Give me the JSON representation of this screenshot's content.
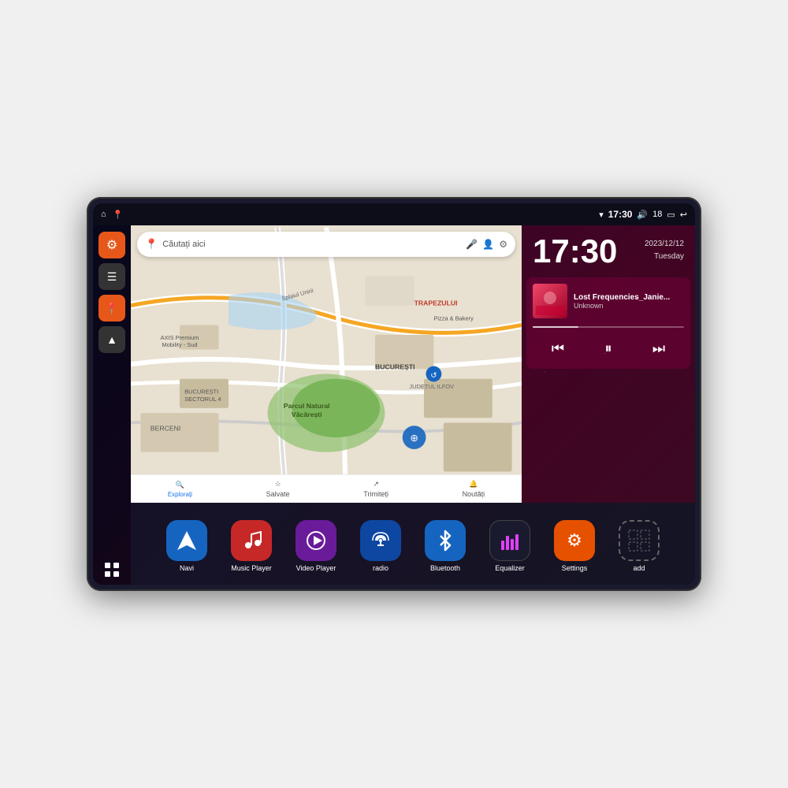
{
  "device": {
    "title": "Car Android Head Unit"
  },
  "statusBar": {
    "leftIcons": [
      "home",
      "maps"
    ],
    "wifi": "▼",
    "time": "17:30",
    "volume": "🔊",
    "battery": "18",
    "batteryIcon": "🔋",
    "back": "↩"
  },
  "sidebar": {
    "buttons": [
      {
        "id": "settings",
        "icon": "⚙",
        "color": "orange"
      },
      {
        "id": "folder",
        "icon": "☰",
        "color": "dark"
      },
      {
        "id": "map",
        "icon": "📍",
        "color": "orange"
      },
      {
        "id": "navigation",
        "icon": "▲",
        "color": "dark"
      }
    ],
    "appsButton": "⋮⋮⋮"
  },
  "map": {
    "searchPlaceholder": "Căutați aici",
    "area": "București",
    "locations": [
      "Parcul Natural Văcărești",
      "AXIS Premium Mobility - Sud",
      "Pizza & Bakery",
      "TRAPEZULUI",
      "BUCUREȘTI SECTORUL 4",
      "BUCUREȘTI",
      "JUDEȚUL ILFOV",
      "BERCENI"
    ],
    "bottomNav": [
      {
        "label": "Explorați",
        "icon": "🔍",
        "active": true
      },
      {
        "label": "Salvate",
        "icon": "☆",
        "active": false
      },
      {
        "label": "Trimiteți",
        "icon": "↗",
        "active": false
      },
      {
        "label": "Noutăți",
        "icon": "🔔",
        "active": false
      }
    ]
  },
  "clock": {
    "time": "17:30",
    "date": "2023/12/12",
    "day": "Tuesday"
  },
  "music": {
    "title": "Lost Frequencies_Janie...",
    "artist": "Unknown",
    "controls": {
      "prev": "⏮",
      "play": "⏸",
      "next": "⏭"
    }
  },
  "apps": [
    {
      "id": "navi",
      "label": "Navi",
      "icon": "▲",
      "color": "blue"
    },
    {
      "id": "music-player",
      "label": "Music Player",
      "icon": "♪",
      "color": "red"
    },
    {
      "id": "video-player",
      "label": "Video Player",
      "icon": "▶",
      "color": "purple"
    },
    {
      "id": "radio",
      "label": "radio",
      "icon": "📻",
      "color": "dark-blue"
    },
    {
      "id": "bluetooth",
      "label": "Bluetooth",
      "icon": "⚡",
      "color": "bt-blue"
    },
    {
      "id": "equalizer",
      "label": "Equalizer",
      "icon": "📊",
      "color": "eq-dark"
    },
    {
      "id": "settings",
      "label": "Settings",
      "icon": "⚙",
      "color": "orange"
    },
    {
      "id": "add",
      "label": "add",
      "icon": "+",
      "color": "add-gray"
    }
  ]
}
